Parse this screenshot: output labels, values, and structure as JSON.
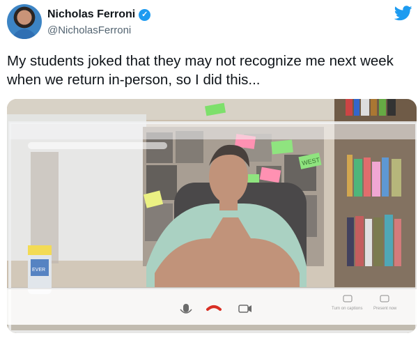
{
  "author": {
    "name": "Nicholas Ferroni",
    "handle": "@NicholasFerroni",
    "verified": true
  },
  "tweet": {
    "text": "My students joked that they may not recognize me next week when we return in-person, so I did this..."
  },
  "icons": {
    "logo": "twitter-bird-icon",
    "verified": "verified-badge-icon",
    "mic": "microphone-icon",
    "hangup": "hang-up-icon",
    "camera": "camera-icon"
  },
  "colors": {
    "twitter_blue": "#1d9bf0",
    "hangup_red": "#d93025"
  },
  "call_overlay": {
    "captions_label": "Turn on captions",
    "present_label": "Present now"
  },
  "sticky_note": {
    "label": "WEST"
  },
  "bottle": {
    "label": "EVER"
  }
}
